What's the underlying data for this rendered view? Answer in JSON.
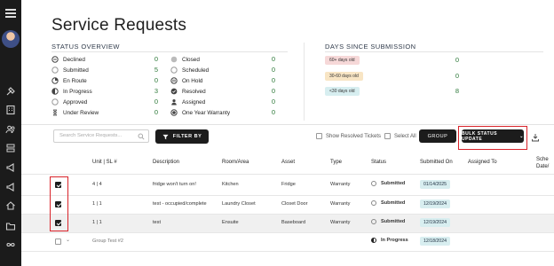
{
  "page": {
    "title": "Service Requests"
  },
  "sidebar": {
    "icons": [
      "hamburger-icon",
      "hammer-icon",
      "building-icon",
      "users-icon",
      "stack-icon",
      "megaphone-icon",
      "megaphone-icon",
      "home-icon",
      "folder-icon",
      "infinity-icon"
    ]
  },
  "overview": {
    "heading": "STATUS OVERVIEW",
    "left": [
      {
        "label": "Declined",
        "count": "0",
        "icon": "minus-circle-icon"
      },
      {
        "label": "Submitted",
        "count": "5",
        "icon": "empty-circle-icon"
      },
      {
        "label": "En Route",
        "count": "0",
        "icon": "quarter-circle-icon"
      },
      {
        "label": "In Progress",
        "count": "3",
        "icon": "half-circle-icon"
      },
      {
        "label": "Approved",
        "count": "0",
        "icon": "empty-circle-icon"
      },
      {
        "label": "Under Review",
        "count": "0",
        "icon": "hourglass-icon"
      }
    ],
    "right": [
      {
        "label": "Closed",
        "count": "0",
        "icon": "filled-circle-icon"
      },
      {
        "label": "Scheduled",
        "count": "0",
        "icon": "empty-circle-icon"
      },
      {
        "label": "On Hold",
        "count": "0",
        "icon": "pause-circle-icon"
      },
      {
        "label": "Resolved",
        "count": "0",
        "icon": "check-circle-icon"
      },
      {
        "label": "Assigned",
        "count": "0",
        "icon": "person-icon"
      },
      {
        "label": "One Year Warranty",
        "count": "0",
        "icon": "dot-circle-icon"
      }
    ]
  },
  "days": {
    "heading": "DAYS SINCE SUBMISSION",
    "items": [
      {
        "label": "60+ days old",
        "count": "0",
        "color": "#f6d8d8"
      },
      {
        "label": "30-60 days old",
        "count": "0",
        "color": "#f8e5c4"
      },
      {
        "label": "<30 days old",
        "count": "8",
        "color": "#d7eef0"
      }
    ]
  },
  "toolbar": {
    "search_placeholder": "Search Service Requests...",
    "filter_label": "FILTER BY",
    "show_resolved_label": "Show Resolved Tickets",
    "select_all_label": "Select All",
    "group_label": "GROUP",
    "bulk_label": "BULK STATUS UPDATE",
    "bulk_chevron": "⌄"
  },
  "table": {
    "headers": [
      "Unit | SL #",
      "Description",
      "Room/Area",
      "Asset",
      "Type",
      "Status",
      "Submitted On",
      "Assigned To",
      "Sche Date/"
    ],
    "rows": [
      {
        "unit": "4 | 4",
        "description": "fridge won't turn on!",
        "room": "Kitchen",
        "asset": "Fridge",
        "type": "Warranty",
        "status": "Submitted",
        "submitted_on": "01/14/2025",
        "checked": true
      },
      {
        "unit": "1 | 1",
        "description": "test - occupied/complete",
        "room": "Laundry Closet",
        "asset": "Closet Door",
        "type": "Warranty",
        "status": "Submitted",
        "submitted_on": "12/19/2024",
        "checked": true
      },
      {
        "unit": "1 | 1",
        "description": "test",
        "room": "Ensuite",
        "asset": "Baseboard",
        "type": "Warranty",
        "status": "Submitted",
        "submitted_on": "12/19/2024",
        "checked": true
      }
    ],
    "group_row": {
      "label": "Group Test #2",
      "status": "In Progress",
      "submitted_on": "12/18/2024",
      "chevron": "⌄"
    }
  }
}
